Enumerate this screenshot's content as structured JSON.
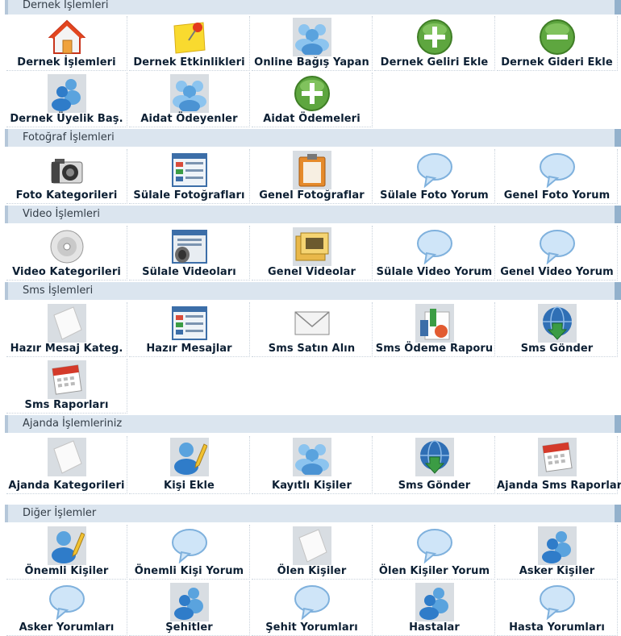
{
  "sections": [
    {
      "title": "Dernek İşlemleri"
    },
    {
      "title": "Fotoğraf İşlemleri"
    },
    {
      "title": "Video İşlemleri"
    },
    {
      "title": "Sms İşlemleri"
    },
    {
      "title": "Ajanda İşlemleriniz"
    },
    {
      "title": "Diğer İşlemler"
    }
  ],
  "tiles": {
    "dernek": [
      {
        "label": "Dernek İşlemleri",
        "icon": "home-icon"
      },
      {
        "label": "Dernek Etkinlikleri",
        "icon": "sticky-note-pin-icon"
      },
      {
        "label": "Online Bağış Yapan",
        "icon": "users-group-icon"
      },
      {
        "label": "Dernek Geliri Ekle",
        "icon": "plus-circle-icon"
      },
      {
        "label": "Dernek Gideri Ekle",
        "icon": "minus-circle-icon"
      },
      {
        "label": "Dernek Üyelik Baş.",
        "icon": "users-pair-icon"
      },
      {
        "label": "Aidat Ödeyenler",
        "icon": "users-group-icon"
      },
      {
        "label": "Aidat Ödemeleri",
        "icon": "plus-circle-icon"
      }
    ],
    "foto": [
      {
        "label": "Foto Kategorileri",
        "icon": "camera-icon"
      },
      {
        "label": "Sülale Fotoğrafları",
        "icon": "gallery-window-icon"
      },
      {
        "label": "Genel Fotoğraflar",
        "icon": "clipboard-photo-icon"
      },
      {
        "label": "Sülale Foto Yorum",
        "icon": "speech-bubble-icon"
      },
      {
        "label": "Genel Foto Yorum",
        "icon": "speech-bubble-icon"
      }
    ],
    "video": [
      {
        "label": "Video Kategorileri",
        "icon": "cd-disc-icon"
      },
      {
        "label": "Sülale Videoları",
        "icon": "video-speaker-icon"
      },
      {
        "label": "Genel Videolar",
        "icon": "film-folder-icon"
      },
      {
        "label": "Sülale Video Yorum",
        "icon": "speech-bubble-icon"
      },
      {
        "label": "Genel Video Yorum",
        "icon": "speech-bubble-icon"
      }
    ],
    "sms": [
      {
        "label": "Hazır Mesaj Kateg.",
        "icon": "paper-sheet-icon"
      },
      {
        "label": "Hazır Mesajlar",
        "icon": "gallery-window-icon"
      },
      {
        "label": "Sms Satın Alın",
        "icon": "envelope-icon"
      },
      {
        "label": "Sms Ödeme Raporu",
        "icon": "report-chart-icon"
      },
      {
        "label": "Sms Gönder",
        "icon": "globe-download-icon"
      },
      {
        "label": "Sms Raporları",
        "icon": "calendar-icon"
      }
    ],
    "ajanda": [
      {
        "label": "Ajanda Kategorileri",
        "icon": "paper-sheet-icon"
      },
      {
        "label": "Kişi Ekle",
        "icon": "user-edit-icon"
      },
      {
        "label": "Kayıtlı Kişiler",
        "icon": "users-group-icon"
      },
      {
        "label": "Sms Gönder",
        "icon": "globe-download-icon"
      },
      {
        "label": "Ajanda Sms Raporları",
        "icon": "calendar-icon"
      }
    ],
    "diger": [
      {
        "label": "Önemli Kişiler",
        "icon": "user-edit-icon"
      },
      {
        "label": "Önemli Kişi Yorum",
        "icon": "speech-bubble-icon"
      },
      {
        "label": "Ölen Kişiler",
        "icon": "paper-sheet-icon"
      },
      {
        "label": "Ölen Kişiler Yorum",
        "icon": "speech-bubble-icon"
      },
      {
        "label": "Asker Kişiler",
        "icon": "users-pair-icon"
      },
      {
        "label": "Asker Yorumları",
        "icon": "speech-bubble-icon"
      },
      {
        "label": "Şehitler",
        "icon": "users-pair-icon"
      },
      {
        "label": "Şehit Yorumları",
        "icon": "speech-bubble-icon"
      },
      {
        "label": "Hastalar",
        "icon": "users-pair-icon"
      },
      {
        "label": "Hasta Yorumları",
        "icon": "speech-bubble-icon"
      }
    ]
  },
  "colors": {
    "header_bg": "#dbe5ef",
    "header_text": "#333d47",
    "label_text": "#0c1f33"
  }
}
